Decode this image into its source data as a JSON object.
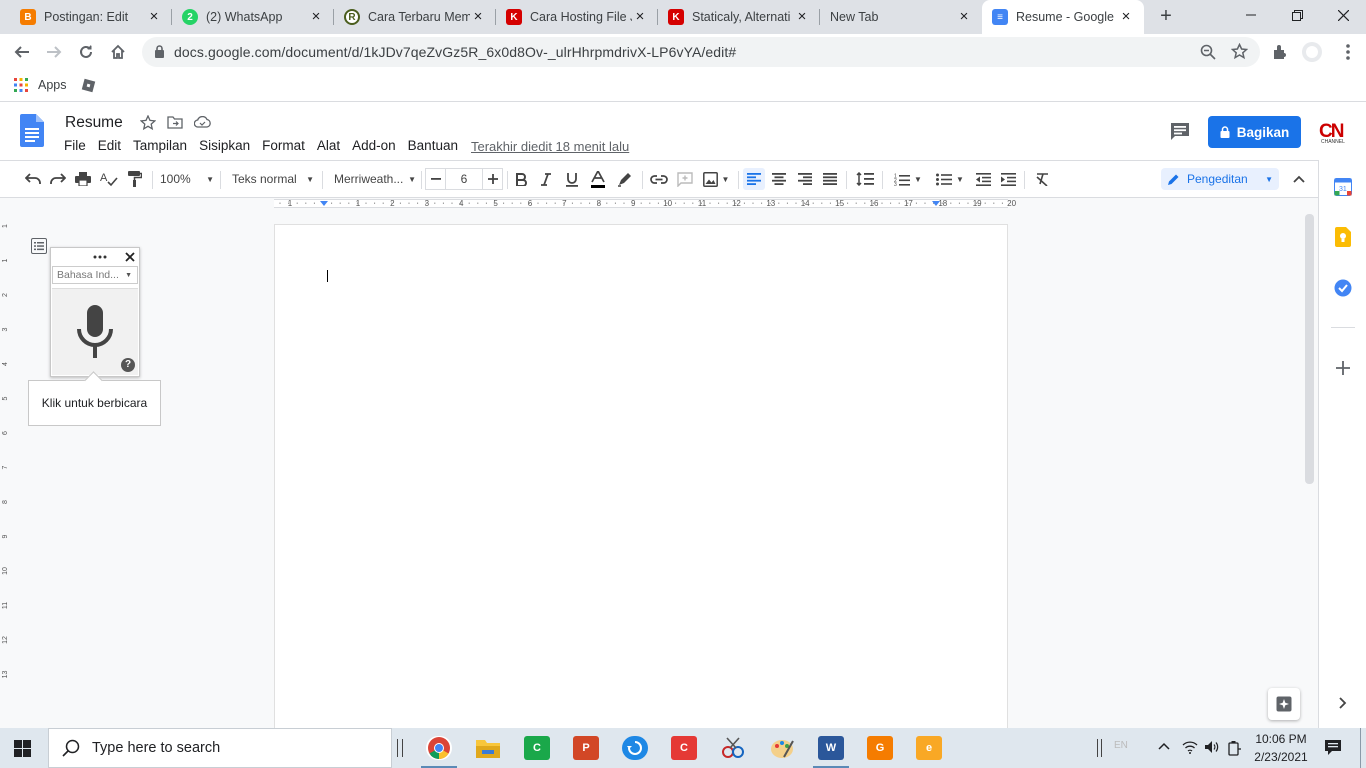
{
  "browser": {
    "tabs": [
      {
        "title": "Postingan: Edit",
        "icon": "blogger-icon",
        "color": "#f57c00",
        "glyph": "B"
      },
      {
        "title": "(2) WhatsApp",
        "icon": "whatsapp-icon",
        "color": "#25d366",
        "glyph": "2"
      },
      {
        "title": "Cara Terbaru Mem",
        "icon": "r-site-icon",
        "color": "#4b5e1e",
        "glyph": "R"
      },
      {
        "title": "Cara Hosting File J",
        "icon": "staticaly-icon",
        "color": "#d50000",
        "glyph": "K"
      },
      {
        "title": "Staticaly, Alternati",
        "icon": "staticaly-icon",
        "color": "#d50000",
        "glyph": "K"
      },
      {
        "title": "New Tab",
        "icon": "",
        "color": "",
        "glyph": ""
      },
      {
        "title": "Resume - Google D",
        "icon": "google-docs-icon",
        "color": "#4285f4",
        "glyph": "≡"
      }
    ],
    "url": "docs.google.com/document/d/1kJDv7qeZvGz5R_6x0d8Ov-_ulrHhrpmdrivX-LP6vYA/edit#",
    "bookmarks": {
      "apps_label": "Apps"
    }
  },
  "docs": {
    "title": "Resume",
    "menu": [
      "File",
      "Edit",
      "Tampilan",
      "Sisipkan",
      "Format",
      "Alat",
      "Add-on",
      "Bantuan"
    ],
    "last_edit": "Terakhir diedit 18 menit lalu",
    "share_label": "Bagikan",
    "toolbar": {
      "zoom": "100%",
      "style": "Teks normal",
      "font": "Merriweath...",
      "font_size": "6",
      "mode": "Pengeditan"
    },
    "ruler_numbers": [
      "1",
      "1",
      "2",
      "3",
      "4",
      "5",
      "6",
      "7",
      "8",
      "9",
      "10",
      "11",
      "12",
      "13",
      "14",
      "15",
      "16",
      "17",
      "18",
      "19",
      "20"
    ],
    "vruler_numbers": [
      "1",
      "1",
      "2",
      "3",
      "4",
      "5",
      "6",
      "7",
      "8",
      "9",
      "10",
      "11",
      "12",
      "13"
    ]
  },
  "voice_typing": {
    "language": "Bahasa Ind...",
    "tooltip": "Klik untuk berbicara",
    "help": "?"
  },
  "taskbar": {
    "search_placeholder": "Type here to search",
    "time": "10:06 PM",
    "date": "2/23/2021",
    "lang": "EN"
  },
  "colors": {
    "accent": "#1a73e8",
    "tab_strip": "#dee1e6",
    "taskbar": "#dfe7ee"
  }
}
